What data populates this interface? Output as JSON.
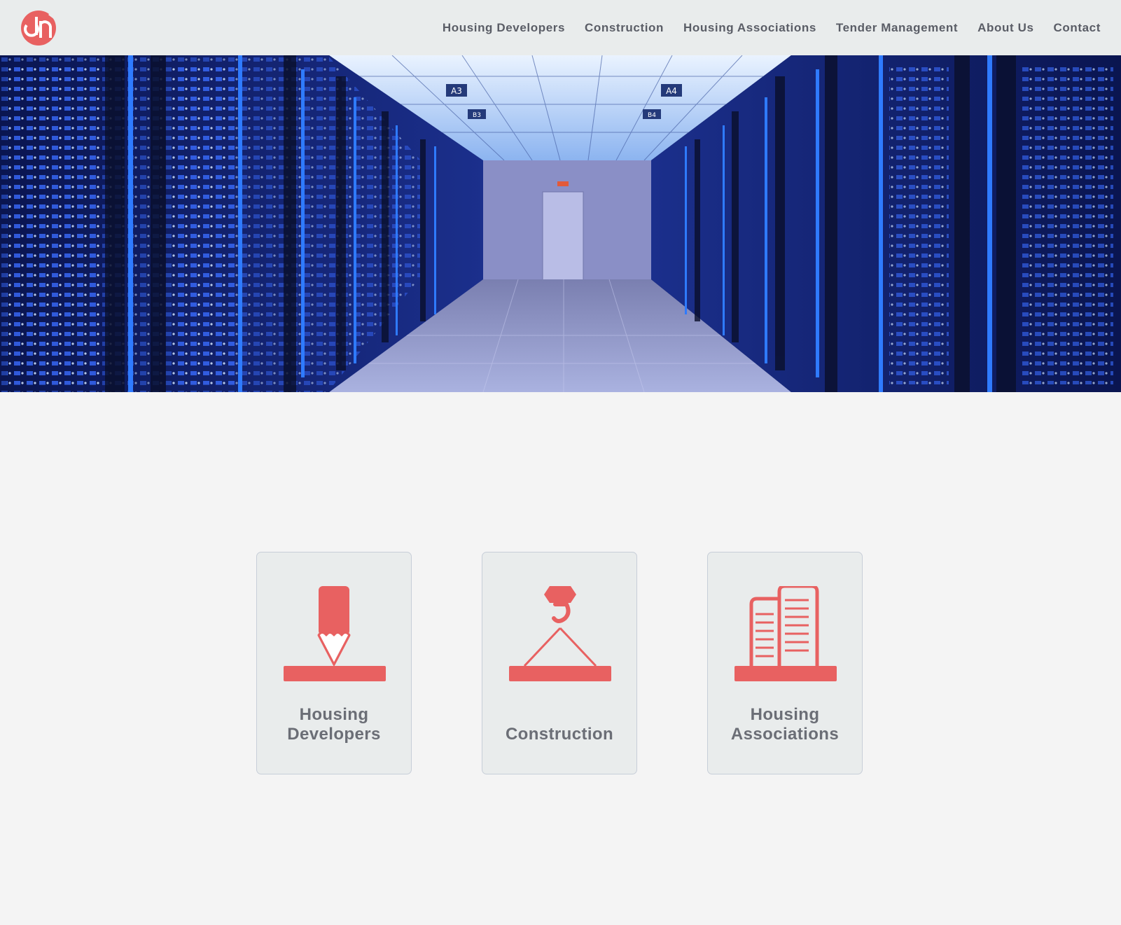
{
  "brand": {
    "logo": "dh-logo",
    "accent_color": "#e86161"
  },
  "nav": {
    "items": [
      {
        "label": "Housing Developers"
      },
      {
        "label": "Construction"
      },
      {
        "label": "Housing Associations"
      },
      {
        "label": "Tender Management"
      },
      {
        "label": "About Us"
      },
      {
        "label": "Contact"
      }
    ]
  },
  "hero": {
    "image": "data-center-server-aisle-photo",
    "rack_labels": [
      "A3",
      "A4",
      "B3",
      "B4"
    ]
  },
  "cards": [
    {
      "icon": "pencil-drafting-icon",
      "line1": "Housing",
      "line2": "Developers"
    },
    {
      "icon": "crane-hook-icon",
      "line1": "Construction"
    },
    {
      "icon": "buildings-icon",
      "line1": "Housing",
      "line2": "Associations"
    }
  ]
}
